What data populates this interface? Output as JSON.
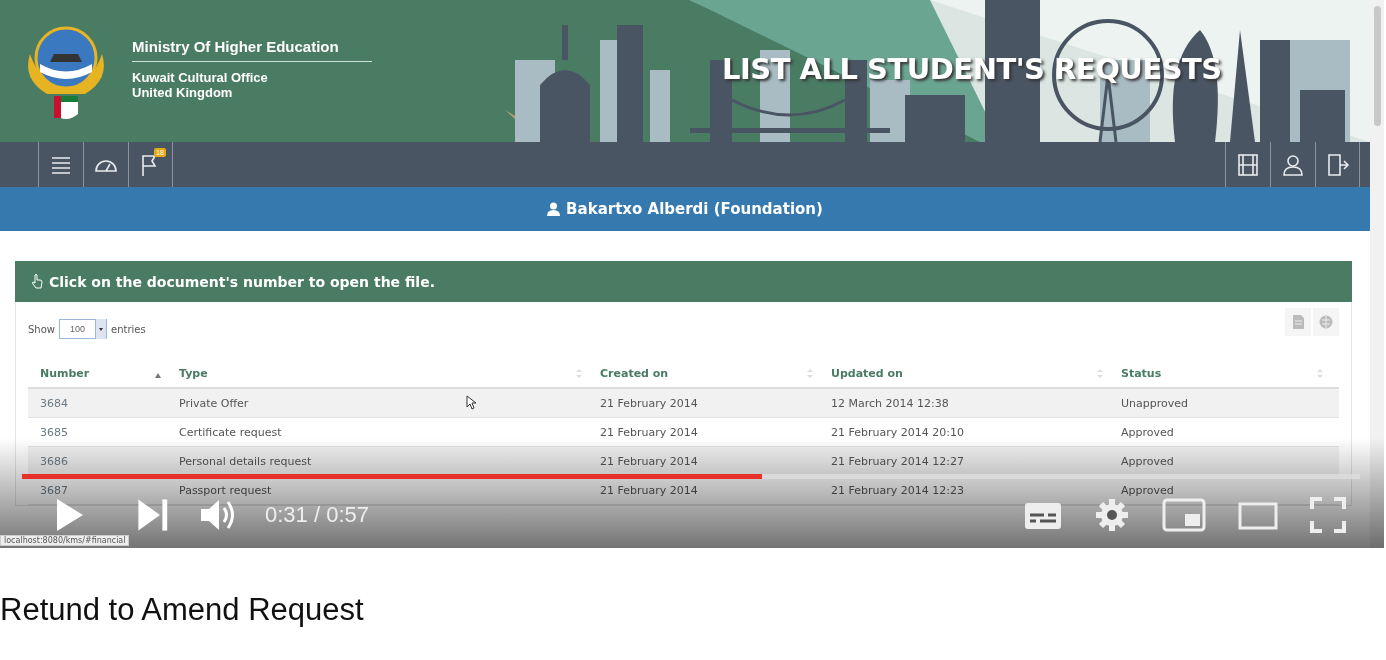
{
  "video": {
    "page": {
      "header": {
        "ministry": "Ministry Of Higher Education",
        "office_lines": [
          "Kuwait Cultural Office",
          "United Kingdom"
        ],
        "banner_title": "LIST ALL STUDENT'S REQUESTS"
      },
      "nav": {
        "notification_count": "18"
      },
      "user_bar": {
        "user": "Bakartxo Alberdi (Foundation)"
      },
      "panel": {
        "hint": "Click on the document's number to open the file.",
        "length": {
          "label_before": "Show",
          "value": "100",
          "label_after": "entries"
        },
        "table": {
          "columns": [
            {
              "label": "Number",
              "sorted": true
            },
            {
              "label": "Type",
              "sorted": false
            },
            {
              "label": "Created on",
              "sorted": false
            },
            {
              "label": "Updated on",
              "sorted": false
            },
            {
              "label": "Status",
              "sorted": false
            }
          ],
          "rows": [
            [
              "3684",
              "Private Offer",
              "21 February 2014",
              "12 March 2014 12:38",
              "Unapproved"
            ],
            [
              "3685",
              "Certificate request",
              "21 February 2014",
              "21 February 2014 20:10",
              "Approved"
            ],
            [
              "3686",
              "Personal details request",
              "21 February 2014",
              "21 February 2014 12:27",
              "Approved"
            ],
            [
              "3687",
              "Passport request",
              "21 February 2014",
              "21 February 2014 12:23",
              "Approved"
            ]
          ]
        }
      },
      "status_url": "localhost:8080/kms/#financial"
    },
    "player": {
      "progress": {
        "level": 0.553
      },
      "time": "0:31 / 0:57"
    }
  },
  "title": "Retund to Amend Request"
}
